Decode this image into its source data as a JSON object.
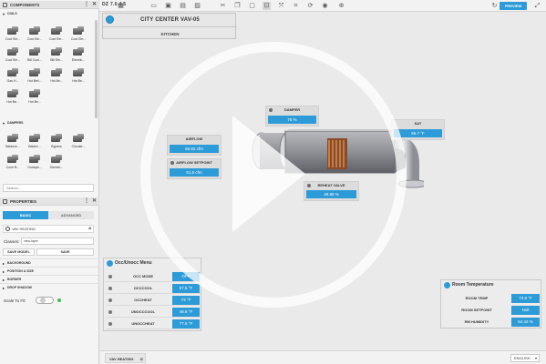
{
  "toolbar": {
    "version": "DZ 7.0.4.5",
    "preview_label": "PREVIEW",
    "icons": [
      "dashboard-icon",
      "folder-icon",
      "save-icon",
      "save-as-icon",
      "image-icon",
      "cut-icon",
      "copy-icon",
      "paste-icon",
      "select-icon",
      "transform-icon",
      "crop-icon",
      "rotate-icon",
      "record-icon",
      "crosshair-icon",
      "refresh-icon",
      "expand-icon"
    ]
  },
  "components": {
    "header": "COMPONENTS",
    "coils": {
      "label": "COILS",
      "items": [
        "Cool Ele...",
        "Cool Ele...",
        "Cool Ele...",
        "Cool Ele...",
        "Cool Ele...",
        "Bill Cool...",
        "Bill Ele...",
        "Electric...",
        "Gas H...",
        "Hot Beli...",
        "Hot Be...",
        "Hot Be...",
        "Hot Be...",
        "Hot Be..."
      ]
    },
    "dampers": {
      "label": "DAMPERS",
      "items": [
        "Balance...",
        "Balanc...",
        "Bypass",
        "Circular...",
        "Cone B...",
        "Honeyw...",
        "Siemen..."
      ]
    },
    "search_placeholder": "Search..."
  },
  "properties": {
    "header": "PROPERTIES",
    "tab_basic": "BASIC",
    "tab_advanced": "ADVANCED",
    "component_name": "VAV HEATING",
    "classes_label": "Classes:",
    "classes_value": "view-layer",
    "save_model": "SAVE MODEL",
    "save": "SAVE",
    "sections": [
      "BACKGROUND",
      "POSITION & SIZE",
      "BORDER",
      "DROP SHADOW"
    ],
    "scale_label": "Scale To Fit:"
  },
  "canvas": {
    "title": "CITY CENTER VAV-05",
    "subtitle": "KITCHEN",
    "damper": {
      "label": "DAMPER",
      "value": "75 %"
    },
    "sat": {
      "label": "SAT",
      "value": "66.7 °F"
    },
    "airflow": {
      "label": "AIRFLOW",
      "value": "55.82 cfm"
    },
    "airflow_sp": {
      "label": "AIRFLOW SETPOINT",
      "value": "51.5 cfm"
    },
    "reheat": {
      "label": "REHEAT VALVE",
      "value": "49.98 %"
    }
  },
  "occ_panel": {
    "title": "Occ/Unocc Menu",
    "rows": [
      {
        "label": "OCC MODE",
        "value": "OFF"
      },
      {
        "label": "OCCCOOL",
        "value": "57.5 °F"
      },
      {
        "label": "OCCHEAT",
        "value": "73 °F"
      },
      {
        "label": "UNOCCCOOL",
        "value": "48.5 °F"
      },
      {
        "label": "UNOCCHEAT",
        "value": "77.5 °F"
      }
    ]
  },
  "room_panel": {
    "title": "Room Temperature",
    "rows": [
      {
        "label": "ROOM TEMP",
        "value": "73.8 °F"
      },
      {
        "label": "ROOM SETPOINT",
        "value": "Null"
      },
      {
        "label": "RM HUMIDITY",
        "value": "54.42 %"
      }
    ]
  },
  "bottom": {
    "tab": "VAV HEATING",
    "language": "ENGLISH"
  },
  "colors": {
    "accent": "#2d9bd8",
    "panel": "#ececec",
    "toggle_on": "#3bbf4a"
  }
}
